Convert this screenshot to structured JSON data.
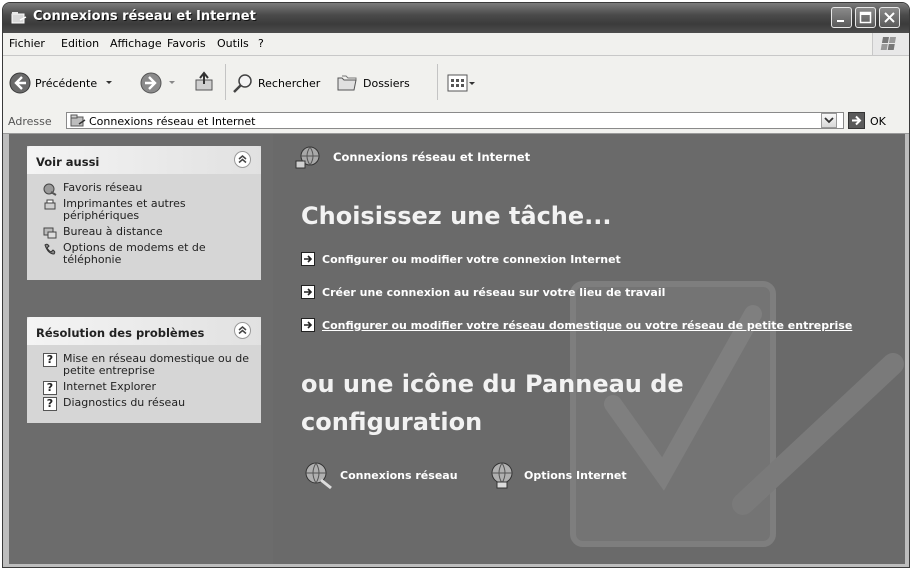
{
  "window": {
    "title": "Connexions réseau et Internet"
  },
  "menu": [
    "Fichier",
    "Edition",
    "Affichage",
    "Favoris",
    "Outils",
    "?"
  ],
  "toolbar": {
    "back_label": "Précédente",
    "search_label": "Rechercher",
    "folders_label": "Dossiers"
  },
  "address": {
    "label": "Adresse",
    "value": "Connexions réseau et Internet",
    "go_label": "OK"
  },
  "see_also": {
    "title": "Voir aussi",
    "items": [
      {
        "label": "Favoris réseau",
        "icon": "network-favorites-icon"
      },
      {
        "label": "Imprimantes et autres périphériques",
        "icon": "printers-icon"
      },
      {
        "label": "Bureau à distance",
        "icon": "remote-desktop-icon"
      },
      {
        "label": "Options de modems et de téléphonie",
        "icon": "phone-modem-icon"
      }
    ]
  },
  "troubleshoot": {
    "title": "Résolution des problèmes",
    "items": [
      {
        "label": "Mise en réseau domestique ou de petite entreprise",
        "icon": "help-icon"
      },
      {
        "label": "Internet Explorer",
        "icon": "help-icon"
      },
      {
        "label": "Diagnostics du réseau",
        "icon": "help-icon"
      }
    ]
  },
  "main": {
    "category_title": "Connexions réseau et Internet",
    "task_heading": "Choisissez une tâche...",
    "tasks": [
      "Configurer ou modifier votre connexion Internet",
      "Créer une connexion au réseau sur votre lieu de travail",
      "Configurer ou modifier votre réseau domestique ou votre réseau de petite entreprise"
    ],
    "icon_heading_line1": "ou une icône du Panneau de",
    "icon_heading_line2": "configuration",
    "control_panel_items": [
      "Connexions réseau",
      "Options Internet"
    ]
  }
}
